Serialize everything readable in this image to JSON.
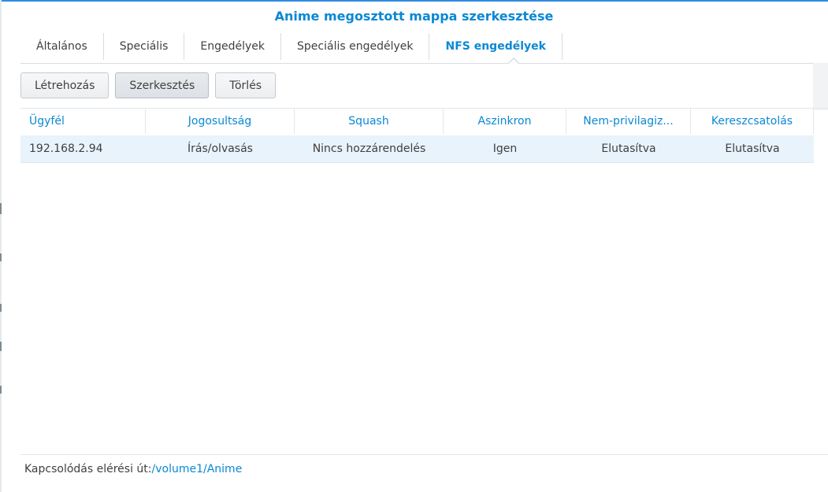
{
  "window": {
    "title": "Anime megosztott mappa szerkesztése"
  },
  "tabs": [
    {
      "label": "Általános",
      "active": false
    },
    {
      "label": "Speciális",
      "active": false
    },
    {
      "label": "Engedélyek",
      "active": false
    },
    {
      "label": "Speciális engedélyek",
      "active": false
    },
    {
      "label": "NFS engedélyek",
      "active": true
    }
  ],
  "toolbar": {
    "create_label": "Létrehozás",
    "edit_label": "Szerkesztés",
    "delete_label": "Törlés"
  },
  "grid": {
    "columns": [
      "Ügyfél",
      "Jogosultság",
      "Squash",
      "Aszinkron",
      "Nem-privilagiz...",
      "Kereszcsatolás"
    ],
    "rows": [
      {
        "client": "192.168.2.94",
        "privilege": "Írás/olvasás",
        "squash": "Nincs hozzárendelés",
        "async": "Igen",
        "non_privileged": "Elutasítva",
        "cross_mount": "Elutasítva",
        "selected": true
      }
    ]
  },
  "footer": {
    "mount_path_label": "Kapcsolódás elérési út:",
    "mount_path": "/volume1/Anime"
  },
  "colors": {
    "accent": "#0b88d4",
    "selected_row": "#e9f3fc",
    "text": "#404040"
  }
}
